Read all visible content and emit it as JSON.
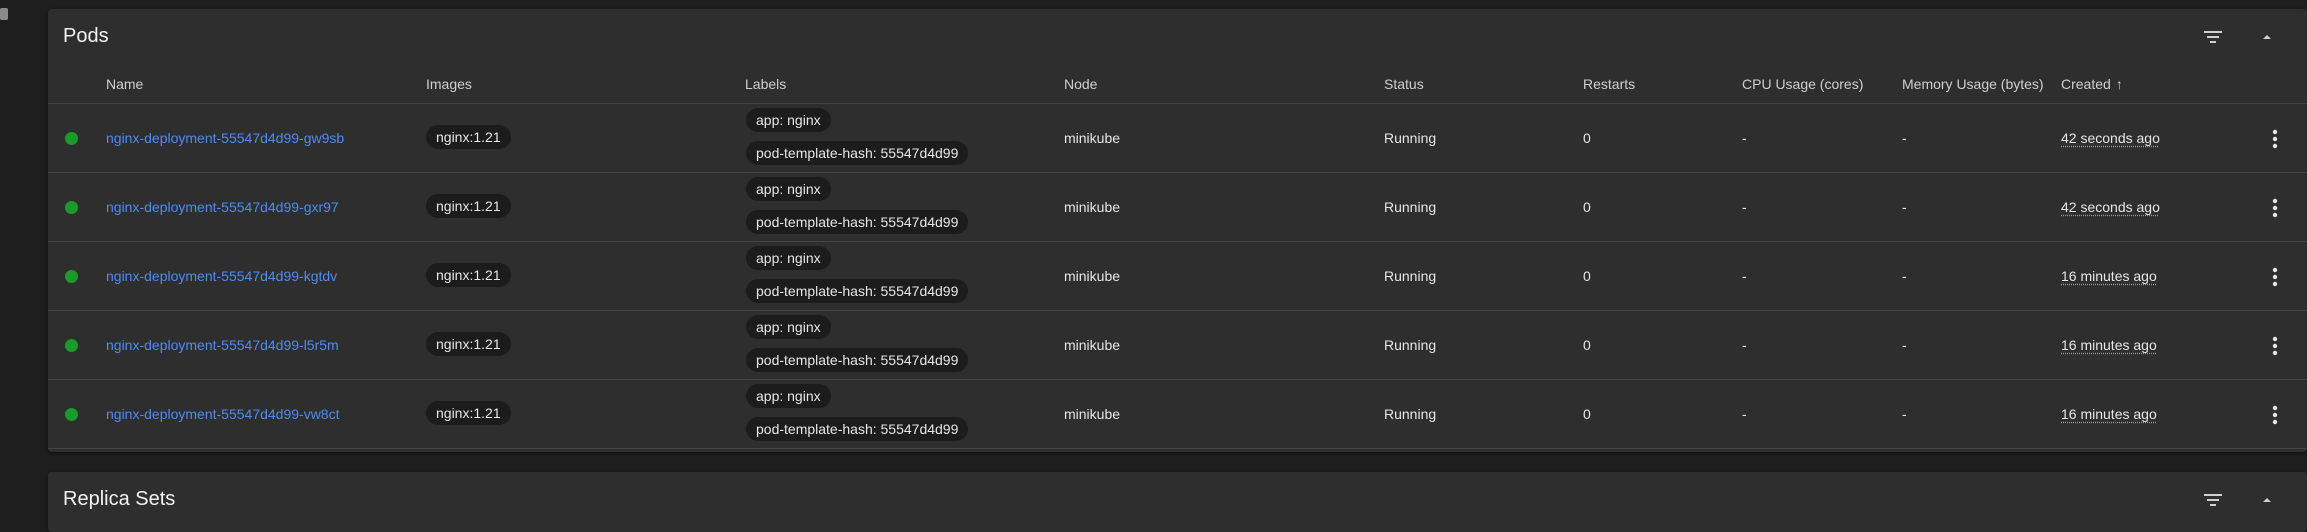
{
  "pods_card": {
    "title": "Pods",
    "columns": {
      "name": "Name",
      "images": "Images",
      "labels": "Labels",
      "node": "Node",
      "status": "Status",
      "restarts": "Restarts",
      "cpu": "CPU Usage (cores)",
      "memory": "Memory Usage (bytes)",
      "created": "Created",
      "created_sort": "↑"
    },
    "rows": [
      {
        "name": "nginx-deployment-55547d4d99-gw9sb",
        "image": "nginx:1.21",
        "label1": "app: nginx",
        "label2": "pod-template-hash: 55547d4d99",
        "node": "minikube",
        "status": "Running",
        "restarts": "0",
        "cpu": "-",
        "memory": "-",
        "created": "42 seconds ago"
      },
      {
        "name": "nginx-deployment-55547d4d99-gxr97",
        "image": "nginx:1.21",
        "label1": "app: nginx",
        "label2": "pod-template-hash: 55547d4d99",
        "node": "minikube",
        "status": "Running",
        "restarts": "0",
        "cpu": "-",
        "memory": "-",
        "created": "42 seconds ago"
      },
      {
        "name": "nginx-deployment-55547d4d99-kgtdv",
        "image": "nginx:1.21",
        "label1": "app: nginx",
        "label2": "pod-template-hash: 55547d4d99",
        "node": "minikube",
        "status": "Running",
        "restarts": "0",
        "cpu": "-",
        "memory": "-",
        "created": "16 minutes ago"
      },
      {
        "name": "nginx-deployment-55547d4d99-l5r5m",
        "image": "nginx:1.21",
        "label1": "app: nginx",
        "label2": "pod-template-hash: 55547d4d99",
        "node": "minikube",
        "status": "Running",
        "restarts": "0",
        "cpu": "-",
        "memory": "-",
        "created": "16 minutes ago"
      },
      {
        "name": "nginx-deployment-55547d4d99-vw8ct",
        "image": "nginx:1.21",
        "label1": "app: nginx",
        "label2": "pod-template-hash: 55547d4d99",
        "node": "minikube",
        "status": "Running",
        "restarts": "0",
        "cpu": "-",
        "memory": "-",
        "created": "16 minutes ago"
      }
    ]
  },
  "replica_sets_card": {
    "title": "Replica Sets"
  },
  "colors": {
    "background": "#1e1e1e",
    "card": "#2e2e2e",
    "link": "#4f8bf2",
    "status_ok": "#1a9a2a"
  },
  "icons": {
    "filter": "filter-icon",
    "collapse": "chevron-up-icon",
    "row_menu": "more-vert-icon"
  }
}
